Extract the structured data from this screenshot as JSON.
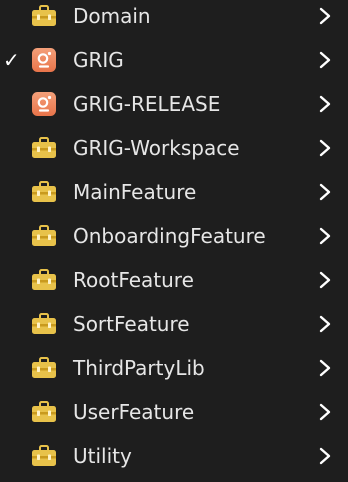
{
  "menu": {
    "items": [
      {
        "label": "Domain",
        "icon": "toolbox-icon",
        "checked": false
      },
      {
        "label": "GRIG",
        "icon": "app-icon",
        "checked": true
      },
      {
        "label": "GRIG-RELEASE",
        "icon": "app-icon",
        "checked": false
      },
      {
        "label": "GRIG-Workspace",
        "icon": "toolbox-icon",
        "checked": false
      },
      {
        "label": "MainFeature",
        "icon": "toolbox-icon",
        "checked": false
      },
      {
        "label": "OnboardingFeature",
        "icon": "toolbox-icon",
        "checked": false
      },
      {
        "label": "RootFeature",
        "icon": "toolbox-icon",
        "checked": false
      },
      {
        "label": "SortFeature",
        "icon": "toolbox-icon",
        "checked": false
      },
      {
        "label": "ThirdPartyLib",
        "icon": "toolbox-icon",
        "checked": false
      },
      {
        "label": "UserFeature",
        "icon": "toolbox-icon",
        "checked": false
      },
      {
        "label": "Utility",
        "icon": "toolbox-icon",
        "checked": false
      }
    ],
    "checkmark_glyph": "✓"
  },
  "colors": {
    "background": "#1e1e1e",
    "text": "#e6e6e6",
    "toolbox_body": "#e8c24a",
    "toolbox_band": "#c99a1e",
    "app_icon_top": "#f4a07a",
    "app_icon_bottom": "#e8744a",
    "chevron": "#ffffff"
  }
}
